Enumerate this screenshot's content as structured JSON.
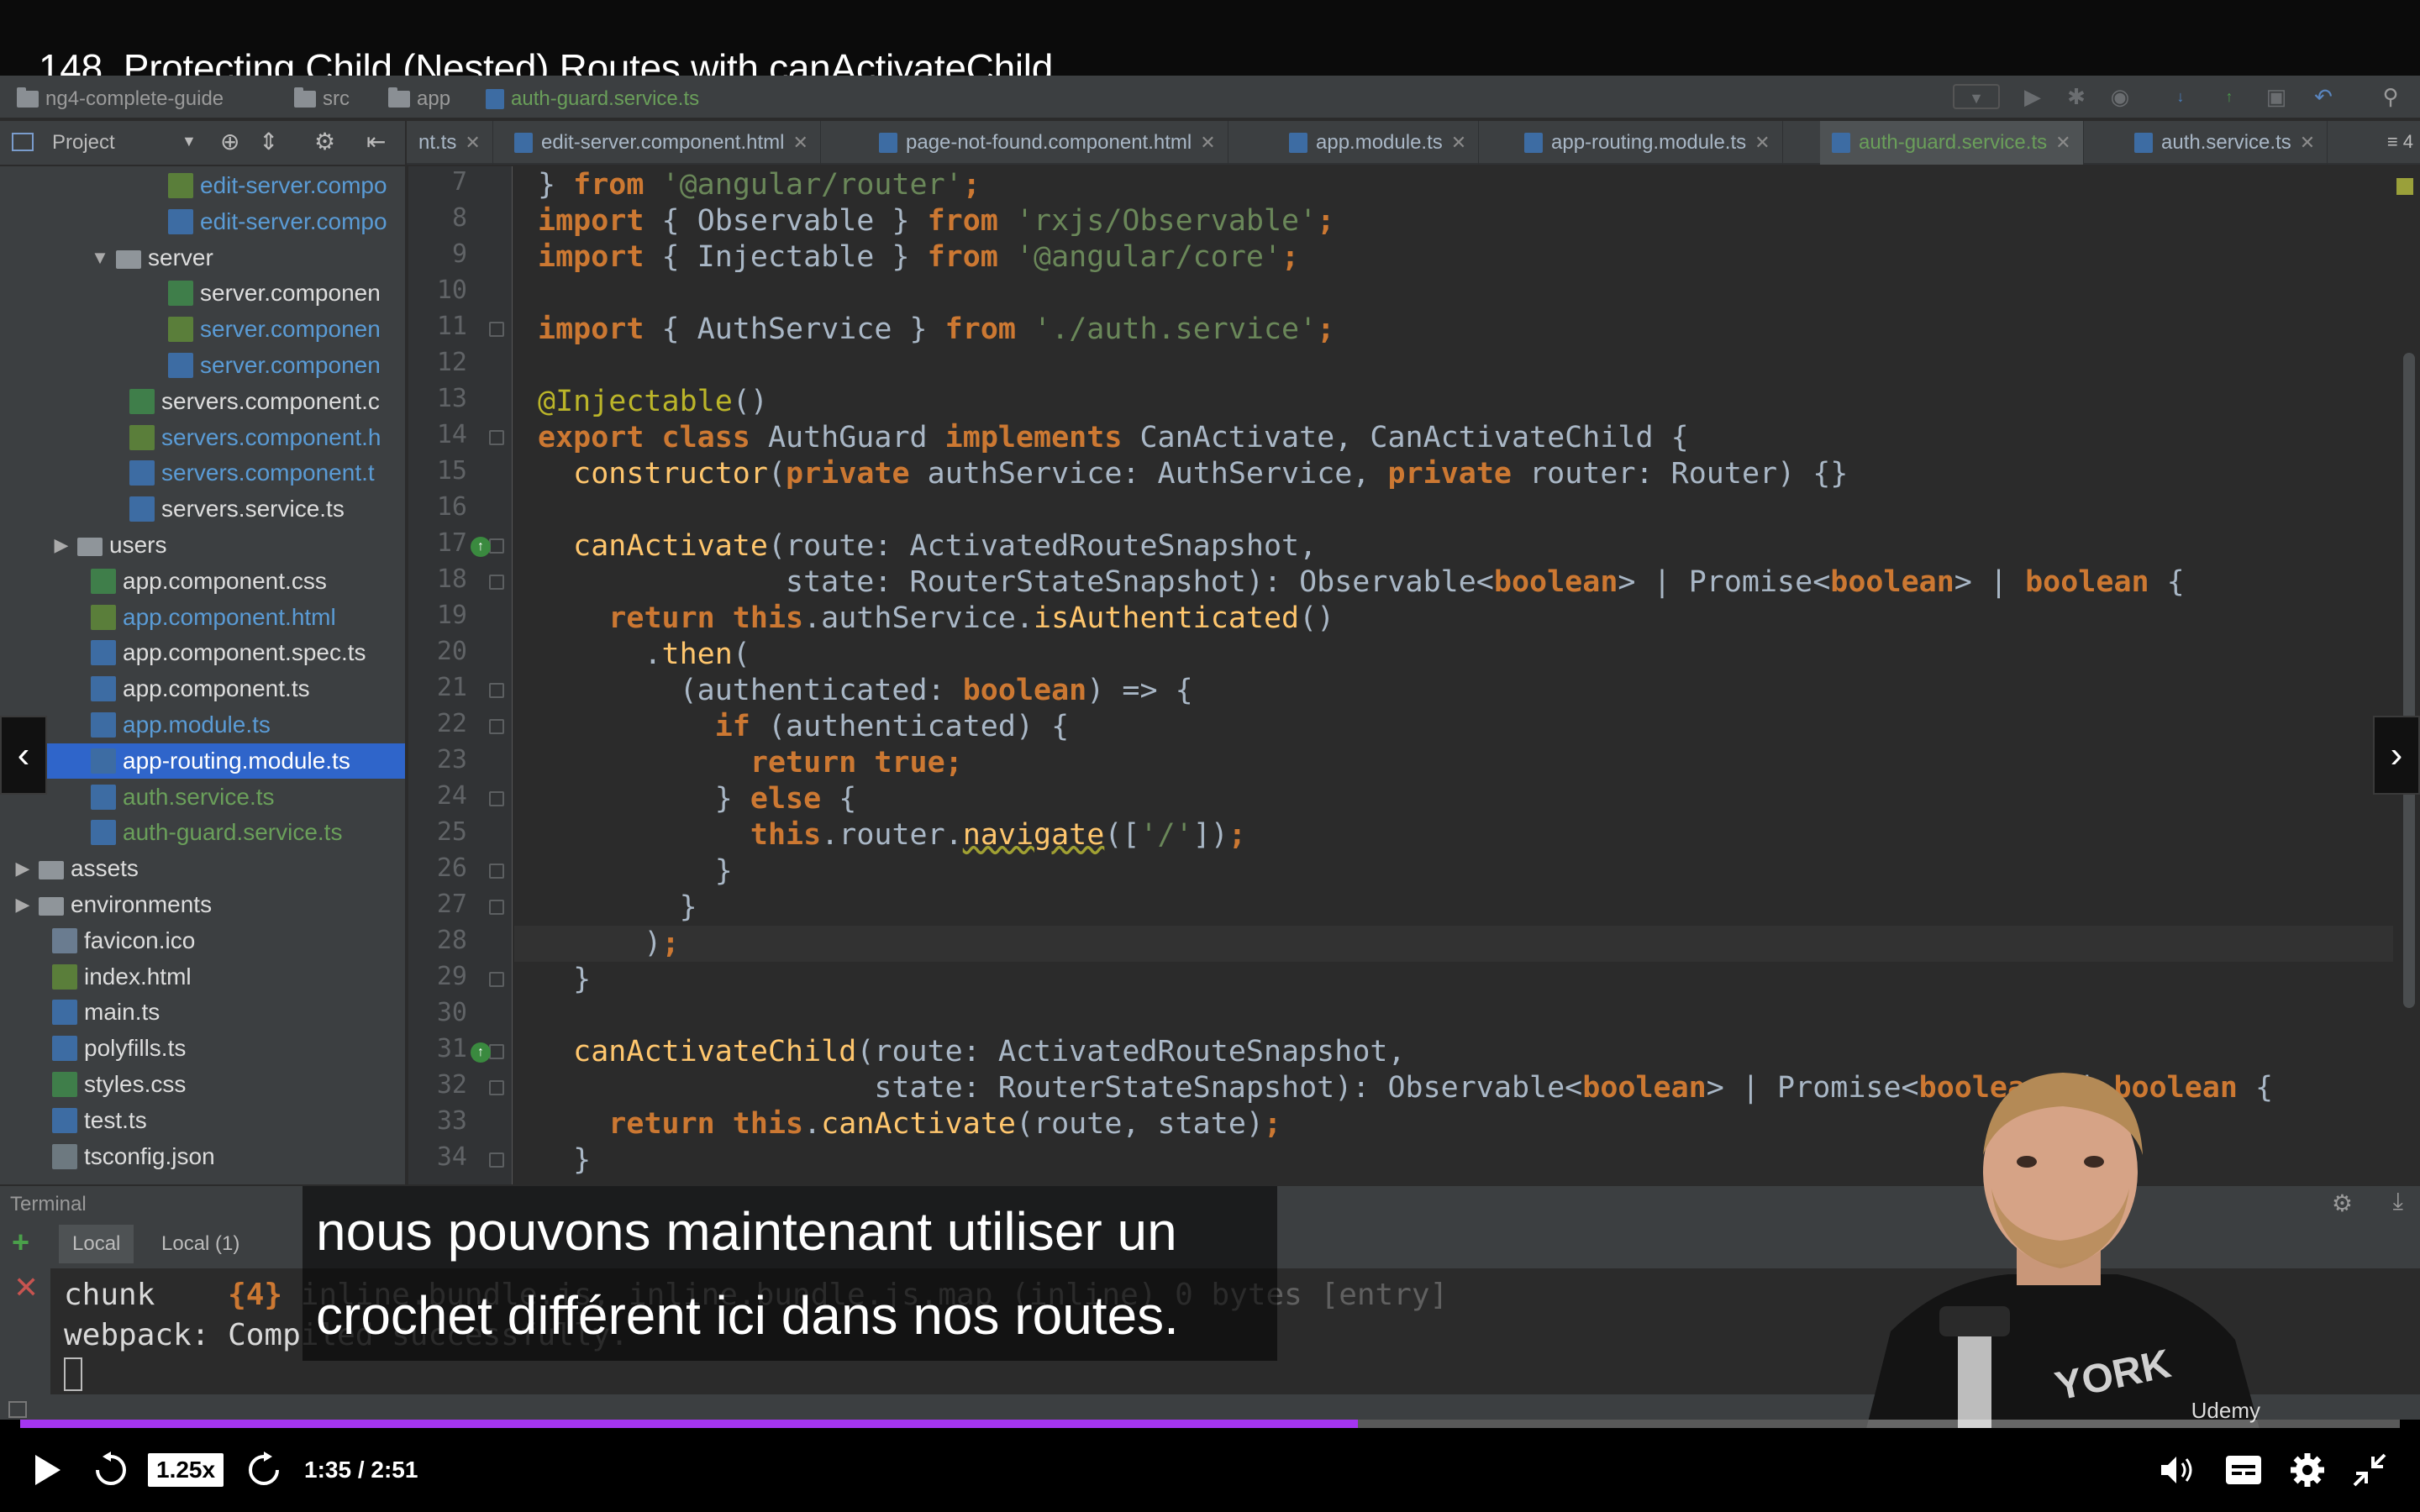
{
  "video": {
    "title": "148. Protecting Child (Nested) Routes with canActivateChild",
    "subtitle": "nous pouvons maintenant utiliser un crochet différent ici dans nos routes.",
    "speed": "1.25x",
    "time": "1:35 / 2:51",
    "progress_fraction": 0.5621,
    "watermark": "Udemy"
  },
  "ide": {
    "breadcrumb": [
      "ng4-complete-guide",
      "src",
      "app",
      "auth-guard.service.ts"
    ],
    "project_label": "Project",
    "tabs": [
      {
        "label": "nt.ts",
        "active": false
      },
      {
        "label": "edit-server.component.html",
        "active": false
      },
      {
        "label": "page-not-found.component.html",
        "active": false
      },
      {
        "label": "app.module.ts",
        "active": false
      },
      {
        "label": "app-routing.module.ts",
        "active": false
      },
      {
        "label": "auth-guard.service.ts",
        "active": true
      },
      {
        "label": "auth.service.ts",
        "active": false
      }
    ],
    "tab_overflow": "≡ 4",
    "tree": [
      {
        "label": "edit-server.compo",
        "indent": 4,
        "type": "html",
        "color": "#5a9bd5"
      },
      {
        "label": "edit-server.compo",
        "indent": 4,
        "type": "ts",
        "color": "#5a9bd5"
      },
      {
        "label": "server",
        "indent": 2,
        "type": "folder",
        "arrow": "▼",
        "color": "#dddddd"
      },
      {
        "label": "server.componen",
        "indent": 4,
        "type": "css",
        "color": "#dddddd"
      },
      {
        "label": "server.componen",
        "indent": 4,
        "type": "html",
        "color": "#5a9bd5"
      },
      {
        "label": "server.componen",
        "indent": 4,
        "type": "ts",
        "color": "#5a9bd5"
      },
      {
        "label": "servers.component.c",
        "indent": 3,
        "type": "css",
        "color": "#dddddd"
      },
      {
        "label": "servers.component.h",
        "indent": 3,
        "type": "html",
        "color": "#5a9bd5"
      },
      {
        "label": "servers.component.t",
        "indent": 3,
        "type": "ts",
        "color": "#5a9bd5"
      },
      {
        "label": "servers.service.ts",
        "indent": 3,
        "type": "ts",
        "color": "#dddddd"
      },
      {
        "label": "users",
        "indent": 1,
        "type": "folder",
        "arrow": "▶",
        "color": "#dddddd"
      },
      {
        "label": "app.component.css",
        "indent": 2,
        "type": "css",
        "color": "#dddddd"
      },
      {
        "label": "app.component.html",
        "indent": 2,
        "type": "html",
        "color": "#5a9bd5"
      },
      {
        "label": "app.component.spec.ts",
        "indent": 2,
        "type": "ts",
        "color": "#dddddd"
      },
      {
        "label": "app.component.ts",
        "indent": 2,
        "type": "ts",
        "color": "#dddddd"
      },
      {
        "label": "app.module.ts",
        "indent": 2,
        "type": "ts",
        "color": "#5a9bd5"
      },
      {
        "label": "app-routing.module.ts",
        "indent": 2,
        "type": "ts",
        "color": "#ffffff",
        "selected": true
      },
      {
        "label": "auth.service.ts",
        "indent": 2,
        "type": "ts",
        "color": "#6a9f5a"
      },
      {
        "label": "auth-guard.service.ts",
        "indent": 2,
        "type": "ts",
        "color": "#6a9f5a"
      },
      {
        "label": "assets",
        "indent": 0,
        "type": "folder",
        "arrow": "▶",
        "color": "#dddddd"
      },
      {
        "label": "environments",
        "indent": 0,
        "type": "folder",
        "arrow": "▶",
        "color": "#dddddd"
      },
      {
        "label": "favicon.ico",
        "indent": 1,
        "type": "ico",
        "color": "#dddddd"
      },
      {
        "label": "index.html",
        "indent": 1,
        "type": "html",
        "color": "#dddddd"
      },
      {
        "label": "main.ts",
        "indent": 1,
        "type": "ts",
        "color": "#dddddd"
      },
      {
        "label": "polyfills.ts",
        "indent": 1,
        "type": "ts",
        "color": "#dddddd"
      },
      {
        "label": "styles.css",
        "indent": 1,
        "type": "css",
        "color": "#dddddd"
      },
      {
        "label": "test.ts",
        "indent": 1,
        "type": "ts",
        "color": "#dddddd"
      },
      {
        "label": "tsconfig.json",
        "indent": 1,
        "type": "json",
        "color": "#dddddd"
      }
    ],
    "line_numbers": [
      "7",
      "8",
      "9",
      "10",
      "11",
      "12",
      "13",
      "14",
      "15",
      "16",
      "17",
      "18",
      "19",
      "20",
      "21",
      "22",
      "23",
      "24",
      "25",
      "26",
      "27",
      "28",
      "29",
      "30",
      "31",
      "32",
      "33",
      "34"
    ],
    "current_line": "28",
    "code": [
      [
        {
          "t": "} "
        },
        {
          "t": "from",
          "c": "kw"
        },
        {
          "t": " "
        },
        {
          "t": "'@angular/router'",
          "c": "str"
        },
        {
          "t": ";",
          "c": "kw"
        }
      ],
      [
        {
          "t": "import",
          "c": "kw"
        },
        {
          "t": " { Observable } "
        },
        {
          "t": "from",
          "c": "kw"
        },
        {
          "t": " "
        },
        {
          "t": "'rxjs/Observable'",
          "c": "str"
        },
        {
          "t": ";",
          "c": "kw"
        }
      ],
      [
        {
          "t": "import",
          "c": "kw"
        },
        {
          "t": " { Injectable } "
        },
        {
          "t": "from",
          "c": "kw"
        },
        {
          "t": " "
        },
        {
          "t": "'@angular/core'",
          "c": "str"
        },
        {
          "t": ";",
          "c": "kw"
        }
      ],
      [],
      [
        {
          "t": "import",
          "c": "kw"
        },
        {
          "t": " { AuthService } "
        },
        {
          "t": "from",
          "c": "kw"
        },
        {
          "t": " "
        },
        {
          "t": "'./auth.service'",
          "c": "str"
        },
        {
          "t": ";",
          "c": "kw"
        }
      ],
      [],
      [
        {
          "t": "@Injectable",
          "c": "ann"
        },
        {
          "t": "()"
        }
      ],
      [
        {
          "t": "export class",
          "c": "kw"
        },
        {
          "t": " AuthGuard "
        },
        {
          "t": "implements",
          "c": "kw"
        },
        {
          "t": " CanActivate, CanActivateChild {"
        }
      ],
      [
        {
          "t": "  "
        },
        {
          "t": "constructor",
          "c": "fn"
        },
        {
          "t": "("
        },
        {
          "t": "private",
          "c": "kw"
        },
        {
          "t": " authService: AuthService, "
        },
        {
          "t": "private",
          "c": "kw"
        },
        {
          "t": " router: Router) {}"
        }
      ],
      [],
      [
        {
          "t": "  "
        },
        {
          "t": "canActivate",
          "c": "fn"
        },
        {
          "t": "(route: ActivatedRouteSnapshot,"
        }
      ],
      [
        {
          "t": "              state: RouterStateSnapshot): Observable<"
        },
        {
          "t": "boolean",
          "c": "kw"
        },
        {
          "t": "> | Promise<"
        },
        {
          "t": "boolean",
          "c": "kw"
        },
        {
          "t": "> | "
        },
        {
          "t": "boolean",
          "c": "kw"
        },
        {
          "t": " {"
        }
      ],
      [
        {
          "t": "    "
        },
        {
          "t": "return this",
          "c": "kw"
        },
        {
          "t": ".authService."
        },
        {
          "t": "isAuthenticated",
          "c": "fn"
        },
        {
          "t": "()"
        }
      ],
      [
        {
          "t": "      ."
        },
        {
          "t": "then",
          "c": "fn"
        },
        {
          "t": "("
        }
      ],
      [
        {
          "t": "        (authenticated: "
        },
        {
          "t": "boolean",
          "c": "kw"
        },
        {
          "t": ") => {"
        }
      ],
      [
        {
          "t": "          "
        },
        {
          "t": "if",
          "c": "kw"
        },
        {
          "t": " (authenticated) {"
        }
      ],
      [
        {
          "t": "            "
        },
        {
          "t": "return true;",
          "c": "kw"
        }
      ],
      [
        {
          "t": "          } "
        },
        {
          "t": "else",
          "c": "kw"
        },
        {
          "t": " {"
        }
      ],
      [
        {
          "t": "            "
        },
        {
          "t": "this",
          "c": "kw"
        },
        {
          "t": ".router."
        },
        {
          "t": "navigate",
          "c": "fn ul"
        },
        {
          "t": "(["
        },
        {
          "t": "'/'",
          "c": "str"
        },
        {
          "t": "])"
        },
        {
          "t": ";",
          "c": "kw"
        }
      ],
      [
        {
          "t": "          }"
        }
      ],
      [
        {
          "t": "        }"
        }
      ],
      [
        {
          "t": "      )"
        },
        {
          "t": ";",
          "c": "kw"
        }
      ],
      [
        {
          "t": "  }"
        }
      ],
      [],
      [
        {
          "t": "  "
        },
        {
          "t": "canActivateChild",
          "c": "fn"
        },
        {
          "t": "(route: ActivatedRouteSnapshot,"
        }
      ],
      [
        {
          "t": "                   state: RouterStateSnapshot): Observable<"
        },
        {
          "t": "boolean",
          "c": "kw"
        },
        {
          "t": "> | Promise<"
        },
        {
          "t": "boolean",
          "c": "kw"
        },
        {
          "t": "> | "
        },
        {
          "t": "boolean",
          "c": "kw"
        },
        {
          "t": " {"
        }
      ],
      [
        {
          "t": "    "
        },
        {
          "t": "return this",
          "c": "kw"
        },
        {
          "t": "."
        },
        {
          "t": "canActivate",
          "c": "fn"
        },
        {
          "t": "(route, state)"
        },
        {
          "t": ";",
          "c": "kw"
        }
      ],
      [
        {
          "t": "  }"
        }
      ]
    ],
    "terminal": {
      "label": "Terminal",
      "tabs": [
        "Local",
        "Local (1)"
      ],
      "lines": [
        [
          {
            "t": "chunk    "
          },
          {
            "t": "{4}",
            "c": "kw"
          },
          {
            "t": " inline.bundle.js, inline.bundle.js.map (inline) 0 bytes [entry]",
            "c": "dim"
          }
        ],
        [
          {
            "t": "webpack: Comp"
          },
          {
            "t": "iled successfully.",
            "c": "dim"
          }
        ]
      ]
    }
  }
}
